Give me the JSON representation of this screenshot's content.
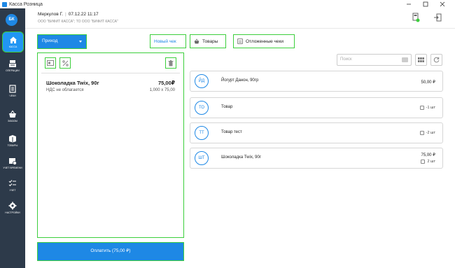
{
  "window": {
    "title": "Касса Розница"
  },
  "sidebar": {
    "logo": "БК",
    "items": [
      {
        "label": "КАССА",
        "icon": "home-icon"
      },
      {
        "label": "ОПЕРАЦИИ",
        "icon": "cash-register-icon"
      },
      {
        "label": "ЧЕКИ",
        "icon": "receipt-icon"
      },
      {
        "label": "ЗАКАЗЫ",
        "icon": "basket-icon"
      },
      {
        "label": "ТОВАРЫ",
        "icon": "box-icon"
      },
      {
        "label": "УЧЕТ ВРЕМЕНИ",
        "icon": "calendar-clock-icon"
      },
      {
        "label": "УЧЕТ",
        "icon": "checklist-icon"
      },
      {
        "label": "НАСТРОЙКИ",
        "icon": "gear-icon"
      }
    ]
  },
  "header": {
    "user": "Меркулов Г.",
    "datetime": "07.12.22 11:17",
    "org": "ООО \"БИФИТ КАССА\"; ТО ООО \"БИФИТ КАССА\""
  },
  "toolbar": {
    "direction": "Приход",
    "new_receipt": "Новый чек",
    "goods": "Товары",
    "deferred": "Отложенные чеки"
  },
  "receipt": {
    "item": {
      "name": "Шоколадка Twix, 90г",
      "price": "75,00₽",
      "vat": "НДС не облагается",
      "qty": "1,000 х 75,00"
    },
    "pay_label": "Оплатить (75,00 ₽)"
  },
  "search": {
    "placeholder": "Поиск"
  },
  "products": [
    {
      "initials": "ЙД",
      "name": "Йогурт Данон, 90гр",
      "price": "50,00 ₽",
      "stock": ""
    },
    {
      "initials": "ТО",
      "name": "Товар",
      "price": "",
      "stock": "-1 шт"
    },
    {
      "initials": "ТТ",
      "name": "Товар тест",
      "price": "",
      "stock": "-2 шт"
    },
    {
      "initials": "ШТ",
      "name": "Шоколадка Twix, 90г",
      "price": "75,00 ₽",
      "stock": "2 шт"
    }
  ],
  "colors": {
    "accent": "#1e88e5",
    "sidebar": "#2d3a4a",
    "highlight": "#3ccf3c"
  }
}
